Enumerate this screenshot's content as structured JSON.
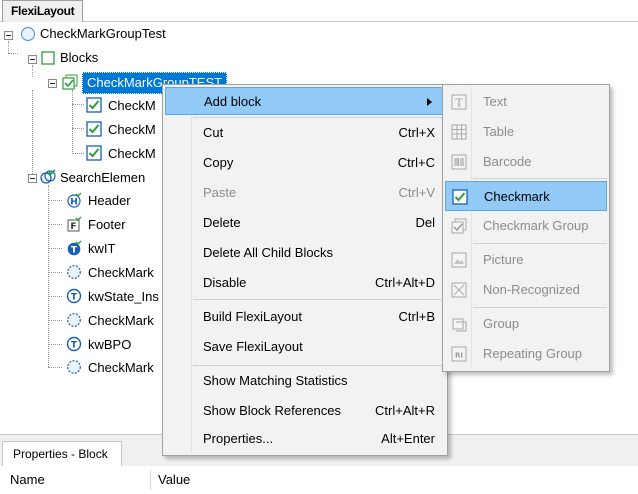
{
  "app": {
    "tab_title": "FlexiLayout"
  },
  "tree": {
    "root": {
      "label": "CheckMarkGroupTest",
      "icon": "circle-node-icon"
    },
    "blocks": {
      "label": "Blocks",
      "icon": "blocks-folder-icon"
    },
    "group": {
      "label": "CheckMarkGroupTEST",
      "icon": "checkmark-group-icon"
    },
    "children": [
      {
        "label": "CheckM",
        "icon": "checkmark-icon"
      },
      {
        "label": "CheckM",
        "icon": "checkmark-icon"
      },
      {
        "label": "CheckM",
        "icon": "checkmark-icon"
      }
    ],
    "search": {
      "label": "SearchElemen",
      "icon": "search-elements-icon"
    },
    "search_children": [
      {
        "label": "Header",
        "icon": "header-icon"
      },
      {
        "label": "Footer",
        "icon": "footer-icon"
      },
      {
        "label": "kwIT",
        "icon": "keyword-icon"
      },
      {
        "label": "CheckMark",
        "icon": "dotted-circle-icon"
      },
      {
        "label": "kwState_Ins",
        "icon": "keyword-icon"
      },
      {
        "label": "CheckMark",
        "icon": "dotted-circle-icon"
      },
      {
        "label": "kwBPO",
        "icon": "keyword-icon"
      },
      {
        "label": "CheckMark",
        "icon": "dotted-circle-icon"
      }
    ]
  },
  "context_menu": {
    "items": [
      {
        "label": "Add block",
        "shortcut": "",
        "submenu": true
      },
      {
        "label": "Cut",
        "shortcut": "Ctrl+X"
      },
      {
        "label": "Copy",
        "shortcut": "Ctrl+C"
      },
      {
        "label": "Paste",
        "shortcut": "Ctrl+V",
        "disabled": true
      },
      {
        "label": "Delete",
        "shortcut": "Del"
      },
      {
        "label": "Delete All Child Blocks",
        "shortcut": ""
      },
      {
        "label": "Disable",
        "shortcut": "Ctrl+Alt+D"
      },
      {
        "label": "Build FlexiLayout",
        "shortcut": "Ctrl+B"
      },
      {
        "label": "Save FlexiLayout",
        "shortcut": ""
      },
      {
        "label": "Show Matching Statistics",
        "shortcut": ""
      },
      {
        "label": "Show Block References",
        "shortcut": "Ctrl+Alt+R"
      },
      {
        "label": "Properties...",
        "shortcut": "Alt+Enter"
      }
    ]
  },
  "submenu": {
    "items": [
      {
        "label": "Text",
        "icon": "text-block-icon"
      },
      {
        "label": "Table",
        "icon": "table-block-icon"
      },
      {
        "label": "Barcode",
        "icon": "barcode-block-icon"
      },
      {
        "label": "Checkmark",
        "icon": "checkmark-block-icon"
      },
      {
        "label": "Checkmark Group",
        "icon": "checkmark-group-block-icon"
      },
      {
        "label": "Picture",
        "icon": "picture-block-icon"
      },
      {
        "label": "Non-Recognized",
        "icon": "non-recognized-block-icon"
      },
      {
        "label": "Group",
        "icon": "group-block-icon"
      },
      {
        "label": "Repeating Group",
        "icon": "repeating-group-block-icon"
      }
    ]
  },
  "properties": {
    "tab_title": "Properties - Block",
    "columns": {
      "name": "Name",
      "value": "Value"
    }
  },
  "colors": {
    "selection": "#0078d7",
    "menu_highlight": "#91c9f7",
    "check_green": "#2e9e3a",
    "icon_blue": "#1a5fb4"
  }
}
